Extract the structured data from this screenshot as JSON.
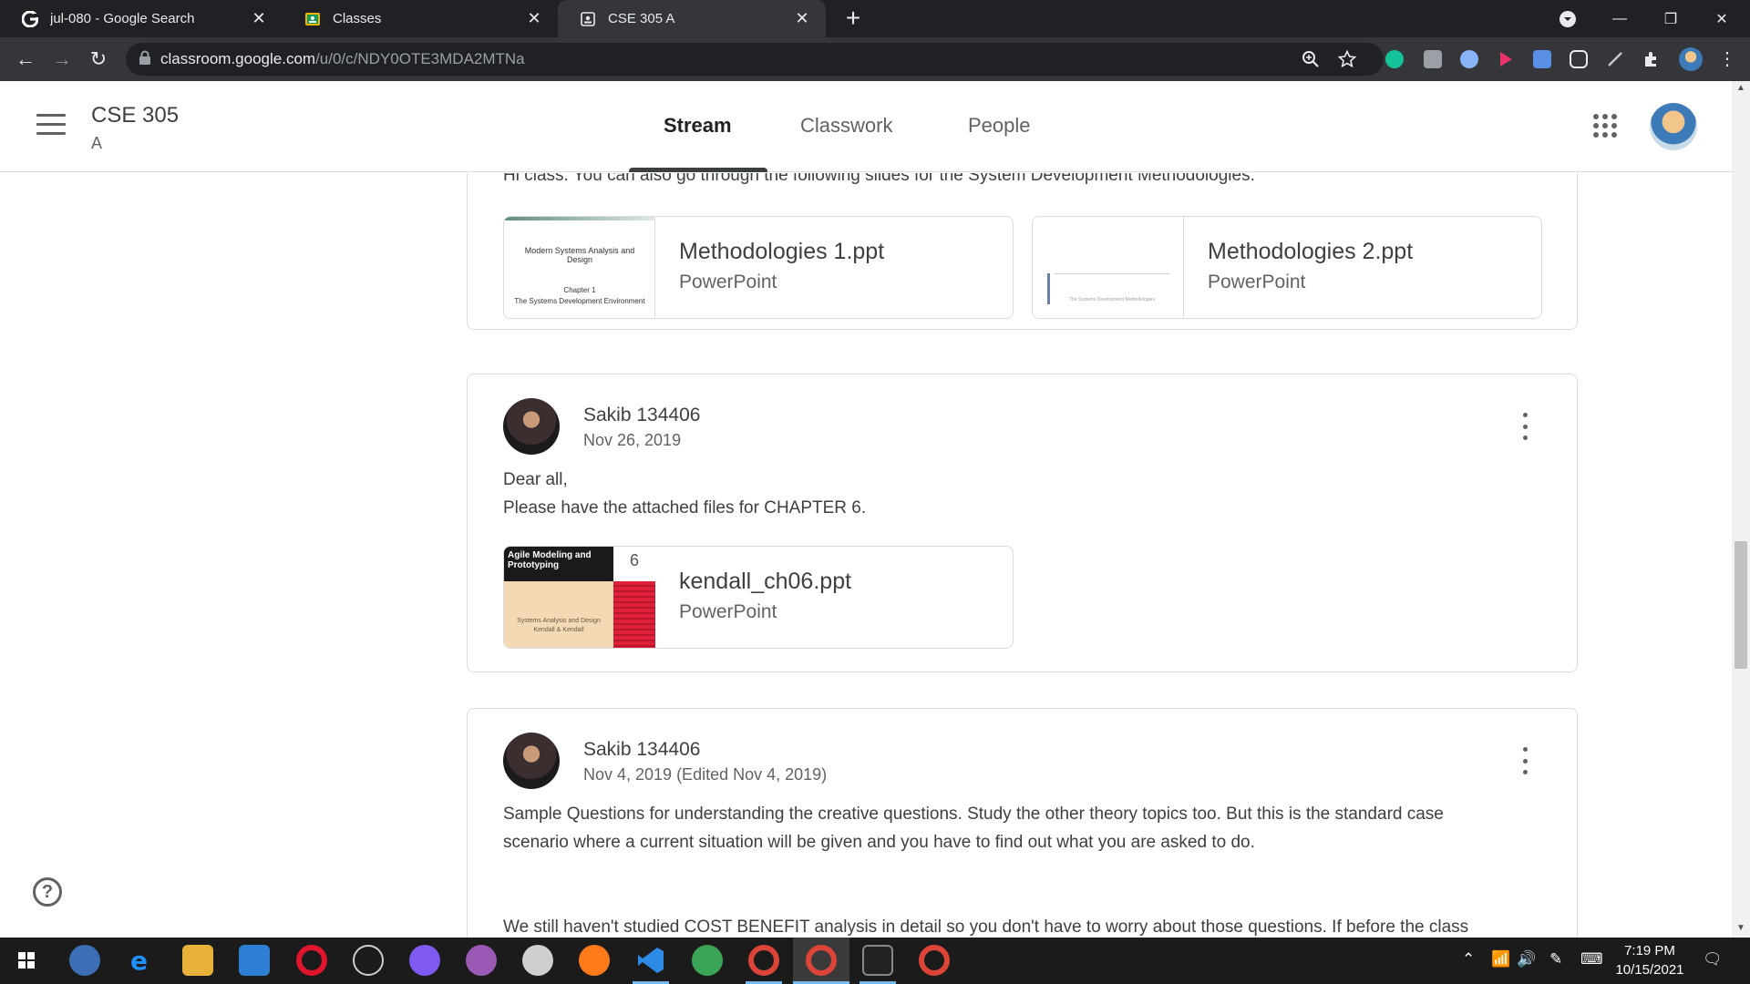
{
  "browser": {
    "tabs": [
      {
        "title": "jul-080 - Google Search",
        "icon": "google-g-icon",
        "active": false
      },
      {
        "title": "Classes",
        "icon": "classroom-icon",
        "active": false
      },
      {
        "title": "CSE 305 A",
        "icon": "classroom-class-icon",
        "active": true
      }
    ],
    "url_host": "classroom.google.com",
    "url_path": "/u/0/c/NDY0OTE3MDA2MTNa"
  },
  "header": {
    "class_name": "CSE 305",
    "section": "A",
    "tabs": [
      "Stream",
      "Classwork",
      "People"
    ],
    "active_tab": "Stream"
  },
  "stream": {
    "partial_post": {
      "text": "Hi class. You can also go through the following slides for the System Development Methodologies.",
      "attachments": [
        {
          "title": "Methodologies 1.ppt",
          "type": "PowerPoint",
          "thumb_line1": "Modern Systems Analysis and Design",
          "thumb_line2": "Chapter 1",
          "thumb_line3": "The Systems Development Environment"
        },
        {
          "title": "Methodologies 2.ppt",
          "type": "PowerPoint",
          "thumb_line1": "The Systems Development Methodologies"
        }
      ]
    },
    "posts": [
      {
        "author": "Sakib 134406",
        "date": "Nov 26, 2019",
        "lines": [
          "Dear all,",
          "Please have the attached files for CHAPTER 6."
        ],
        "attachment": {
          "title": "kendall_ch06.ppt",
          "type": "PowerPoint",
          "thumb_title": "Agile Modeling and Prototyping",
          "thumb_number": "6",
          "thumb_sub1": "Systems Analysis and Design",
          "thumb_sub2": "Kendall & Kendall"
        }
      },
      {
        "author": "Sakib 134406",
        "date": "Nov 4, 2019 (Edited Nov 4, 2019)",
        "lines": [
          "Sample Questions for understanding the creative questions. Study the other theory topics too. But this is the standard case",
          "scenario where a current situation will be given and you have to find out what you are asked to do.",
          "We still haven't studied COST BENEFIT analysis in detail so you don't have to worry about those questions. If before the class"
        ]
      }
    ]
  },
  "help": {
    "label": "?"
  },
  "taskbar": {
    "time": "7:19 PM",
    "date": "10/15/2021"
  },
  "colors": {
    "chrome_dark": "#202124",
    "chrome_toolbar": "#35363a",
    "text_primary": "#3c4043",
    "text_secondary": "#5f6368",
    "border": "#dadce0"
  }
}
